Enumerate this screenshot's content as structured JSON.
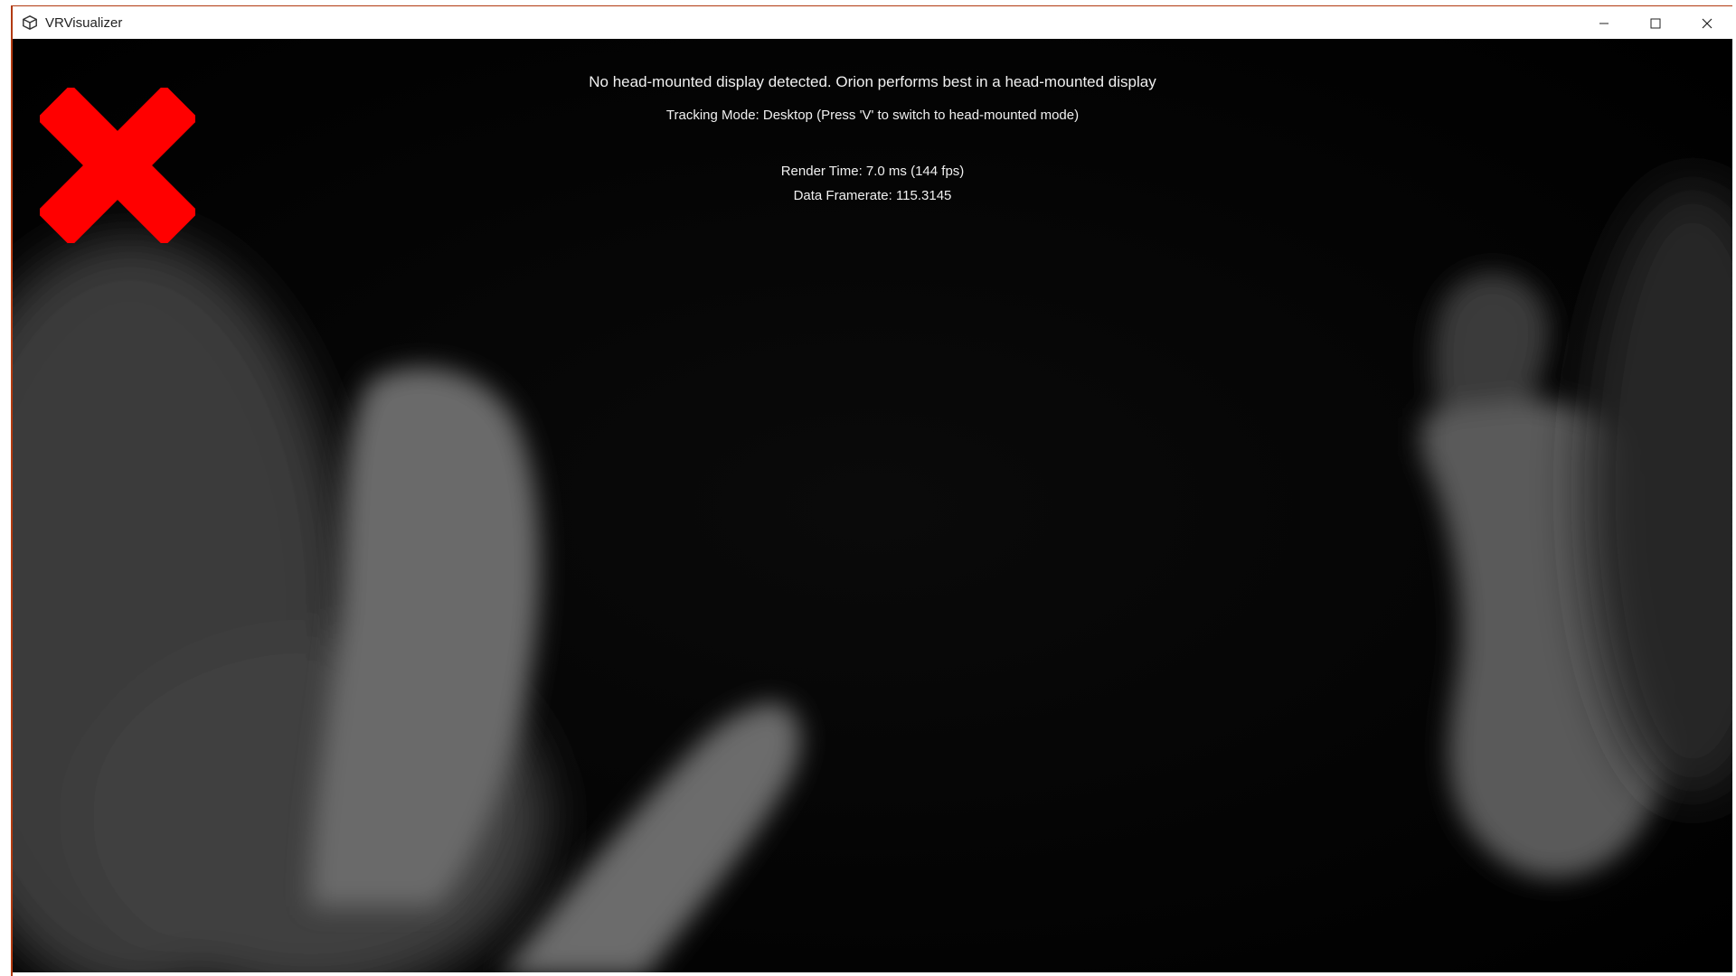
{
  "window": {
    "title": "VRVisualizer",
    "app_icon": "unity-icon",
    "controls": [
      {
        "name": "minimize-button",
        "icon": "minimize-icon"
      },
      {
        "name": "maximize-button",
        "icon": "maximize-icon"
      },
      {
        "name": "close-button",
        "icon": "close-icon"
      }
    ],
    "accent_color": "#b23a10"
  },
  "overlay": {
    "hmd_message": "No head-mounted display detected. Orion performs best in a head-mounted display",
    "tracking_mode": "Tracking Mode: Desktop (Press 'V' to switch to head-mounted mode)",
    "render_time": "Render Time: 7.0 ms (144 fps)",
    "data_framerate": "Data Framerate: 115.3145"
  },
  "marker": {
    "icon": "red-x-icon",
    "color": "#ff0000"
  }
}
